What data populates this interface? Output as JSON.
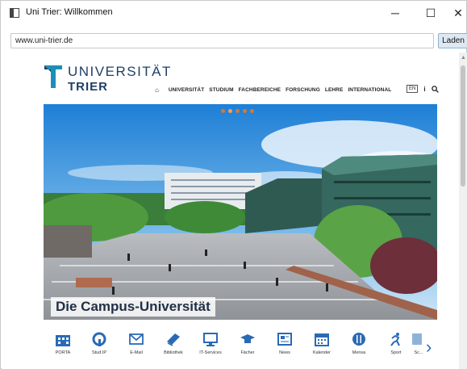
{
  "window": {
    "title": "Uni Trier: Willkommen",
    "controls": {
      "minimize": "─",
      "maximize": "☐",
      "close": "✕"
    }
  },
  "toolbar": {
    "url": "www.uni-trier.de",
    "load_label": "Laden"
  },
  "site": {
    "logo_line1": "UNIVERSITÄT",
    "logo_line2": "TRIER",
    "nav": [
      "UNIVERSITÄT",
      "STUDIUM",
      "FACHBEREICHE",
      "FORSCHUNG",
      "LEHRE",
      "INTERNATIONAL"
    ],
    "lang": "EN",
    "info": "i",
    "hero_caption": "Die Campus-Universität",
    "quicklinks": [
      "PORTA",
      "Stud.IP",
      "E-Mail",
      "Bibliothek",
      "IT-Services",
      "Fächer",
      "News",
      "Kalender",
      "Mensa",
      "Sport",
      "Sc..."
    ],
    "colors": {
      "brand": "#1f3f66",
      "accent": "#2a6ab5",
      "logo_teal": "#1b8fb8"
    }
  }
}
